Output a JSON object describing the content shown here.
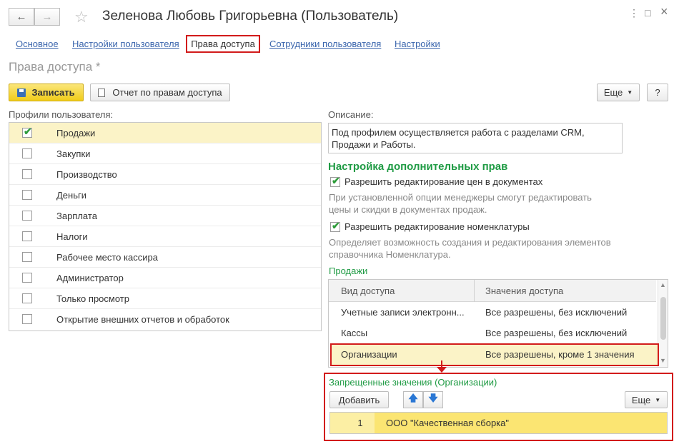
{
  "window": {
    "title": "Зеленова Любовь Григорьевна (Пользователь)",
    "back_icon": "←",
    "forward_icon": "→",
    "star_icon": "☆",
    "menu_icon": "⋮",
    "maximize_icon": "□",
    "close_icon": "×"
  },
  "tabs": [
    {
      "label": "Основное"
    },
    {
      "label": "Настройки пользователя"
    },
    {
      "label": "Права доступа"
    },
    {
      "label": "Сотрудники пользователя"
    },
    {
      "label": "Настройки"
    }
  ],
  "page": {
    "title": "Права доступа *"
  },
  "toolbar": {
    "save_label": "Записать",
    "report_label": "Отчет по правам доступа",
    "more_label": "Еще",
    "help_label": "?"
  },
  "profiles": {
    "label": "Профили пользователя:",
    "items": [
      {
        "label": "Продажи",
        "checked": true
      },
      {
        "label": "Закупки",
        "checked": false
      },
      {
        "label": "Производство",
        "checked": false
      },
      {
        "label": "Деньги",
        "checked": false
      },
      {
        "label": "Зарплата",
        "checked": false
      },
      {
        "label": "Налоги",
        "checked": false
      },
      {
        "label": "Рабочее место кассира",
        "checked": false
      },
      {
        "label": "Администратор",
        "checked": false
      },
      {
        "label": "Только просмотр",
        "checked": false
      },
      {
        "label": "Открытие внешних отчетов и обработок",
        "checked": false
      }
    ]
  },
  "description": {
    "label": "Описание:",
    "line1": "Под профилем осуществляется работа с разделами CRM,",
    "line2": "Продажи и Работы."
  },
  "extra_rights": {
    "heading": "Настройка дополнительных прав",
    "option1": {
      "label": "Разрешить редактирование цен в документах",
      "checked": true,
      "hint1": "При установленной опции менеджеры смогут редактировать",
      "hint2": "цены и скидки в документах продаж."
    },
    "option2": {
      "label": "Разрешить редактирование номенклатуры",
      "checked": true,
      "hint1": "Определяет возможность создания и редактирования элементов",
      "hint2": "справочника Номенклатура."
    }
  },
  "sales": {
    "label": "Продажи",
    "columns": [
      "Вид доступа",
      "Значения доступа"
    ],
    "rows": [
      {
        "kind": "Учетные записи электронн...",
        "value": "Все разрешены, без исключений"
      },
      {
        "kind": "Кассы",
        "value": "Все разрешены, без исключений"
      },
      {
        "kind": "Организации",
        "value": "Все разрешены, кроме 1 значения"
      }
    ]
  },
  "forbidden": {
    "label": "Запрещенные значения (Организации)",
    "add_label": "Добавить",
    "up_icon": "🡅",
    "down_icon": "🡇",
    "more_label": "Еще",
    "rows": [
      {
        "num": "1",
        "name": "ООО \"Качественная сборка\""
      }
    ]
  },
  "colors": {
    "accent_green": "#1f9b44",
    "highlight_red": "#d21b1b",
    "selection_yellow": "#fbe572",
    "link_blue": "#3b66ad"
  }
}
